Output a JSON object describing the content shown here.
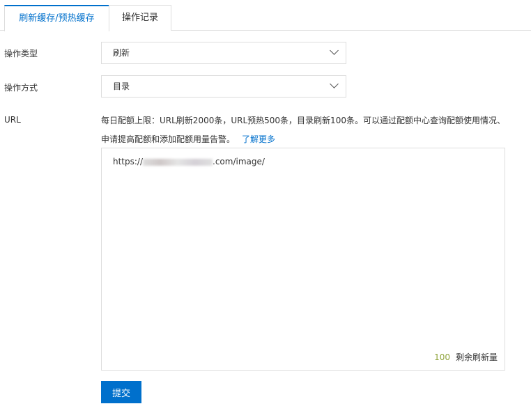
{
  "tabs": [
    {
      "label": "刷新缓存/预热缓存",
      "active": true
    },
    {
      "label": "操作记录",
      "active": false
    }
  ],
  "form": {
    "type": {
      "label": "操作类型",
      "value": "刷新"
    },
    "method": {
      "label": "操作方式",
      "value": "目录"
    },
    "url": {
      "label": "URL",
      "hint": "每日配额上限：URL刷新2000条，URL预热500条，目录刷新100条。可以通过配额中心查询配额使用情况、申请提高配额和添加配额用量告警。",
      "learn_more": "了解更多",
      "value_prefix": "https://",
      "value_suffix": ".com/image/",
      "remaining_count": "100",
      "remaining_label": "剩余刷新量"
    },
    "submit": "提交"
  },
  "colors": {
    "accent": "#0070cc",
    "count": "#8fa33a"
  }
}
